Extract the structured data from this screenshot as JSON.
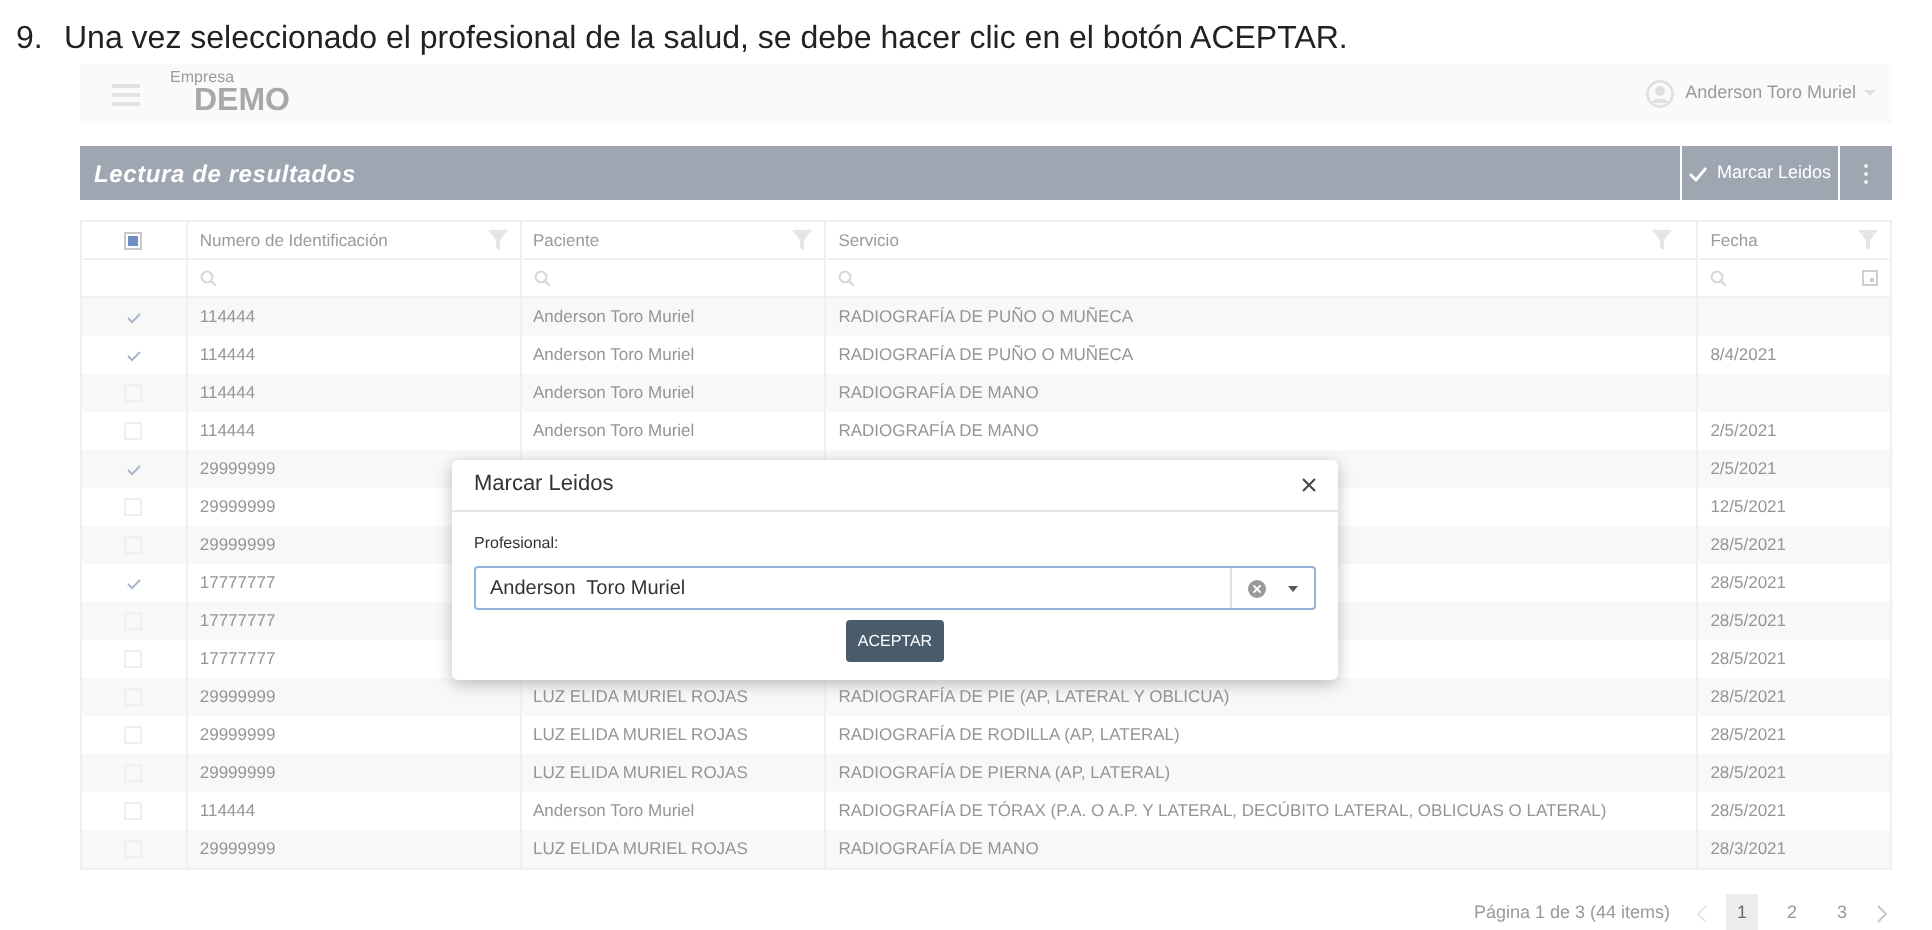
{
  "instruction": {
    "number": "9.",
    "text": "Una vez seleccionado el profesional de la salud, se debe hacer clic en el botón ACEPTAR."
  },
  "header": {
    "company_label": "Empresa",
    "company_name": "DEMO",
    "user": "Anderson Toro Muriel"
  },
  "toolbar": {
    "title": "Lectura de resultados",
    "action": "Marcar Leidos"
  },
  "table": {
    "select_all_indeterminate": true,
    "columns": [
      "Numero de Identificación",
      "Paciente",
      "Servicio",
      "Fecha"
    ],
    "rows": [
      {
        "checked": true,
        "id": "114444",
        "patient": "Anderson Toro Muriel",
        "service": "RADIOGRAFÍA DE PUÑO O MUÑECA"
      },
      {
        "checked": true,
        "id": "114444",
        "patient": "Anderson Toro Muriel",
        "service": "RADIOGRAFÍA DE PUÑO O MUÑECA",
        "date": "8/4/2021"
      },
      {
        "checked": false,
        "id": "114444",
        "patient": "Anderson Toro Muriel",
        "service": "RADIOGRAFÍA DE MANO"
      },
      {
        "checked": false,
        "id": "114444",
        "patient": "Anderson Toro Muriel",
        "service": "RADIOGRAFÍA DE MANO",
        "date": "2/5/2021"
      },
      {
        "checked": true,
        "id": "29999999",
        "date": "2/5/2021"
      },
      {
        "checked": false,
        "id": "29999999",
        "date": "12/5/2021"
      },
      {
        "checked": false,
        "id": "29999999",
        "date": "28/5/2021"
      },
      {
        "checked": true,
        "id": "17777777",
        "date": "28/5/2021"
      },
      {
        "checked": false,
        "id": "17777777",
        "date": "28/5/2021"
      },
      {
        "checked": false,
        "id": "17777777",
        "date": "28/5/2021"
      },
      {
        "checked": false,
        "id": "29999999",
        "patient": "LUZ ELIDA MURIEL ROJAS",
        "service": "RADIOGRAFÍA DE PIE (AP, LATERAL Y OBLICUA)",
        "date": "28/5/2021"
      },
      {
        "checked": false,
        "id": "29999999",
        "patient": "LUZ ELIDA MURIEL ROJAS",
        "service": "RADIOGRAFÍA DE RODILLA (AP, LATERAL)",
        "date": "28/5/2021"
      },
      {
        "checked": false,
        "id": "29999999",
        "patient": "LUZ ELIDA MURIEL ROJAS",
        "service": "RADIOGRAFÍA DE PIERNA (AP, LATERAL)",
        "date": "28/5/2021"
      },
      {
        "checked": false,
        "id": "114444",
        "patient": "Anderson Toro Muriel",
        "service": "RADIOGRAFÍA DE TÓRAX (P.A. O A.P. Y LATERAL, DECÚBITO LATERAL, OBLICUAS O LATERAL)",
        "date": "28/5/2021"
      },
      {
        "checked": false,
        "id": "29999999",
        "patient": "LUZ ELIDA MURIEL ROJAS",
        "service": "RADIOGRAFÍA DE MANO",
        "date": "28/3/2021"
      }
    ]
  },
  "dialog": {
    "title": "Marcar Leidos",
    "field_label": "Profesional:",
    "value": "Anderson  Toro Muriel",
    "button": "ACEPTAR"
  },
  "pager": {
    "summary": "Página 1 de 3 (44 items)",
    "pages": [
      {
        "label": "1",
        "selected": true
      },
      {
        "label": "2",
        "selected": false
      },
      {
        "label": "3",
        "selected": false
      }
    ]
  }
}
